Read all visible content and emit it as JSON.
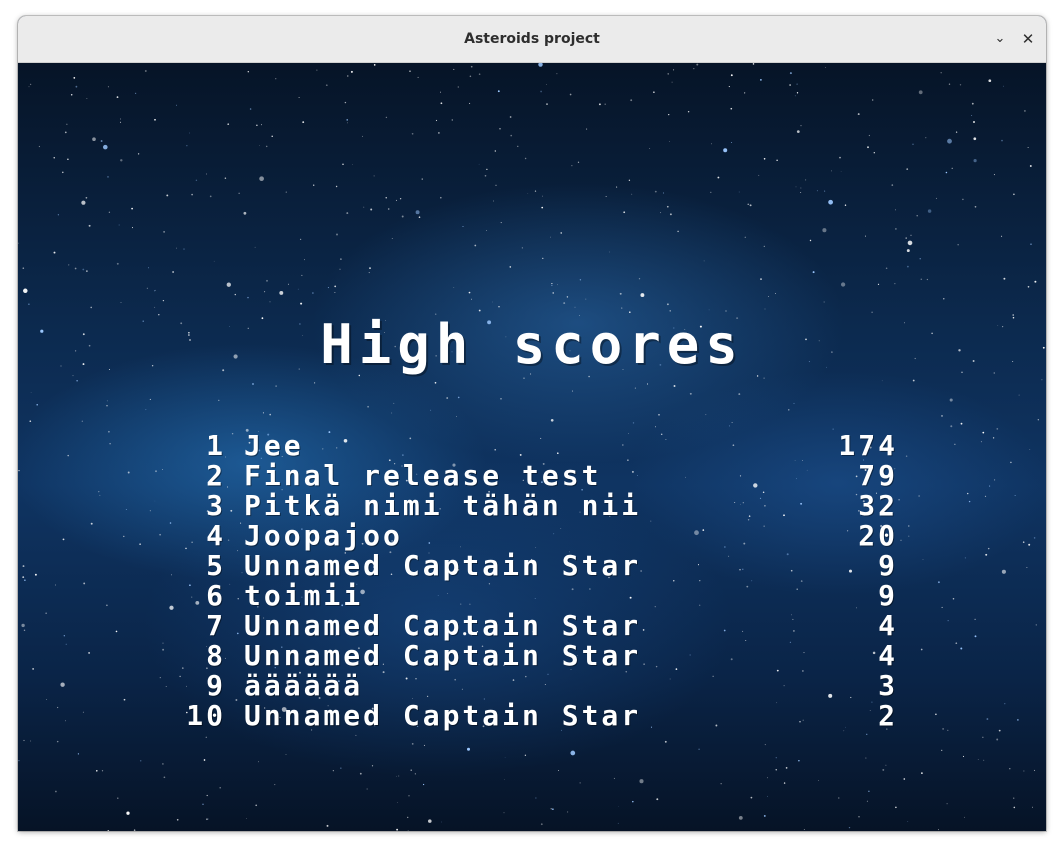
{
  "window": {
    "title": "Asteroids project",
    "minimize_icon": "chevron-down-icon",
    "close_icon": "close-icon",
    "minimize_glyph": "⌄",
    "close_glyph": "✕"
  },
  "game": {
    "heading": "High scores",
    "scores": [
      {
        "rank": "1",
        "name": "Jee",
        "score": "174"
      },
      {
        "rank": "2",
        "name": "Final release test",
        "score": "79"
      },
      {
        "rank": "3",
        "name": "Pitkä nimi tähän nii",
        "score": "32"
      },
      {
        "rank": "4",
        "name": "Joopajoo",
        "score": "20"
      },
      {
        "rank": "5",
        "name": "Unnamed Captain Star",
        "score": "9"
      },
      {
        "rank": "6",
        "name": "toimii",
        "score": "9"
      },
      {
        "rank": "7",
        "name": "Unnamed Captain Star",
        "score": "4"
      },
      {
        "rank": "8",
        "name": "Unnamed Captain Star",
        "score": "4"
      },
      {
        "rank": "9",
        "name": "ääääää",
        "score": "3"
      },
      {
        "rank": "10",
        "name": "Unnamed Captain Star",
        "score": "2"
      }
    ]
  },
  "colors": {
    "titlebar": "#ebebeb",
    "text": "#ffffff",
    "space_dark": "#061427",
    "space_blue": "#0f3462"
  }
}
